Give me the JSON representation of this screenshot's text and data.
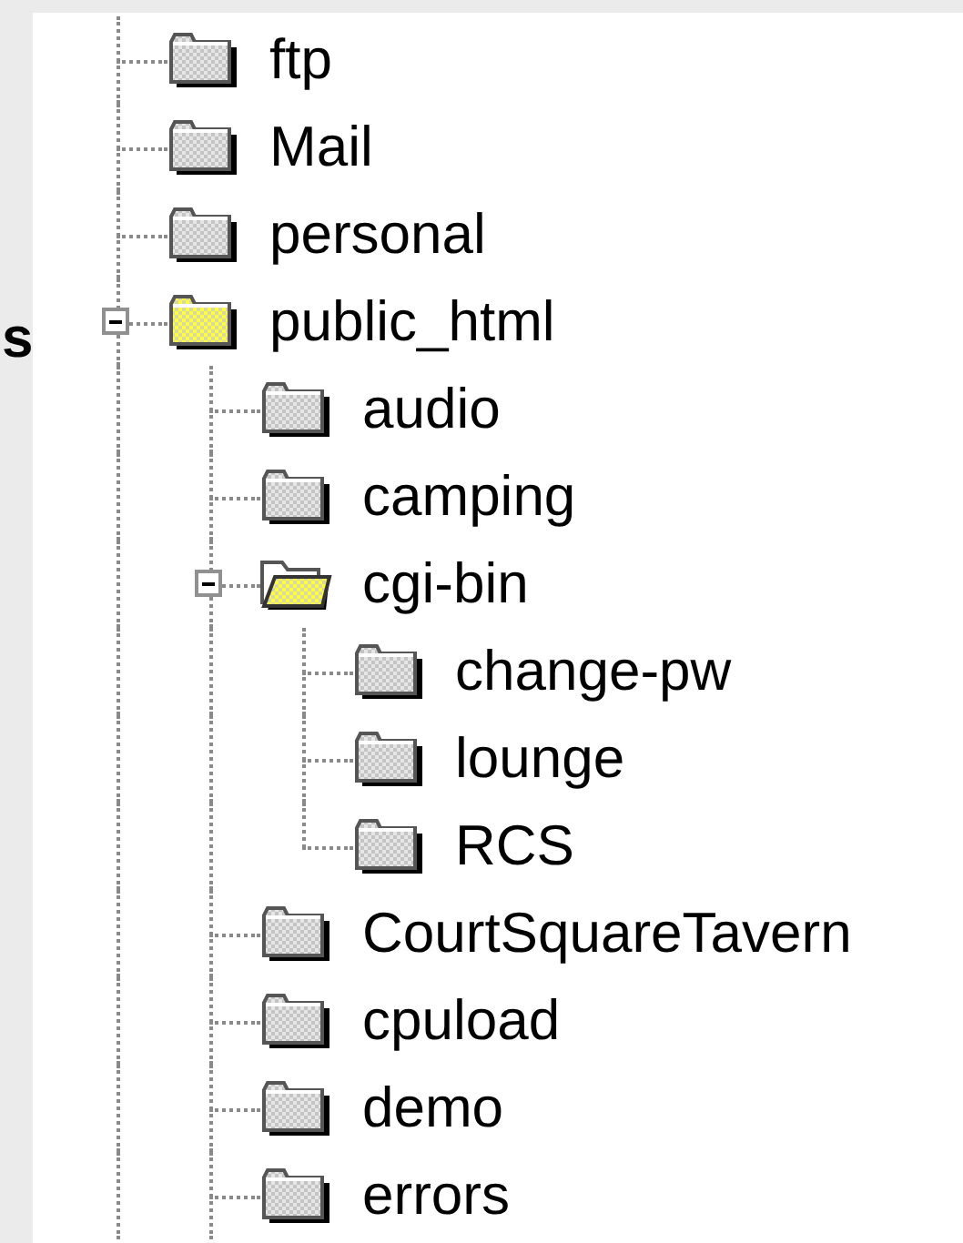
{
  "side_text": "s",
  "tree": {
    "continues": true,
    "items": [
      {
        "label": "ftp",
        "kind": "folder"
      },
      {
        "label": "Mail",
        "kind": "folder"
      },
      {
        "label": "personal",
        "kind": "folder"
      },
      {
        "label": "public_html",
        "kind": "folder-yellow",
        "expanded": true,
        "children_continue": true,
        "children": [
          {
            "label": "audio",
            "kind": "folder"
          },
          {
            "label": "camping",
            "kind": "folder"
          },
          {
            "label": "cgi-bin",
            "kind": "folder-open",
            "expanded": true,
            "children_continue": false,
            "children": [
              {
                "label": "change-pw",
                "kind": "folder"
              },
              {
                "label": "lounge",
                "kind": "folder"
              },
              {
                "label": "RCS",
                "kind": "folder"
              }
            ]
          },
          {
            "label": "CourtSquareTavern",
            "kind": "folder"
          },
          {
            "label": "cpuload",
            "kind": "folder"
          },
          {
            "label": "demo",
            "kind": "folder"
          },
          {
            "label": "errors",
            "kind": "folder"
          }
        ]
      }
    ]
  }
}
